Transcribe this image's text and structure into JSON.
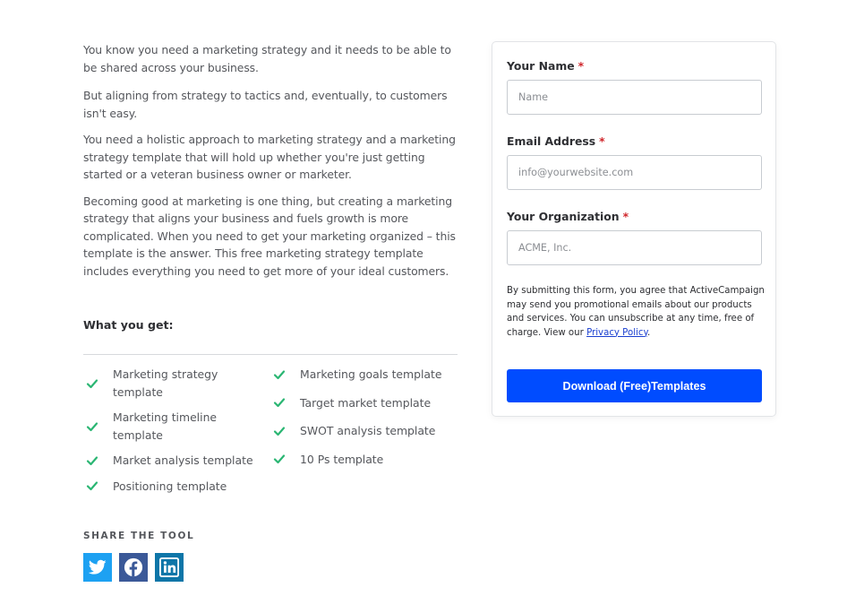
{
  "intro": {
    "paragraphs": [
      "You know you need a marketing strategy and it needs to be able to be shared across your business.",
      "But aligning from strategy to tactics and, eventually, to customers isn't easy.",
      "You need a holistic approach to marketing strategy and a marketing strategy template that will hold up whether you're just getting started or a veteran business owner or marketer.",
      "Becoming good at marketing is one thing, but creating a marketing strategy that aligns your business and fuels growth is more complicated. When you need to get your marketing organized – this template is the answer. This free marketing strategy template includes everything you need to get more of your ideal customers."
    ]
  },
  "what_you_get": {
    "title": "What you get:",
    "column1": [
      "Marketing strategy template",
      "Marketing timeline template",
      "Market analysis template",
      "Positioning template"
    ],
    "column2": [
      "Marketing goals template",
      "Target market template",
      "SWOT analysis template",
      "10 Ps template"
    ],
    "check_icon": "checkmark-icon",
    "check_color": "#2bb673"
  },
  "share": {
    "title": "SHARE THE TOOL",
    "networks": [
      {
        "name": "Twitter",
        "icon": "twitter-icon",
        "color": "#1da1f2"
      },
      {
        "name": "Facebook",
        "icon": "facebook-icon",
        "color": "#3b5998"
      },
      {
        "name": "LinkedIn",
        "icon": "linkedin-icon",
        "color": "#0e76a8"
      }
    ]
  },
  "form": {
    "name_label": "Your Name",
    "name_placeholder": "Name",
    "email_label": "Email Address",
    "email_placeholder": "info@yourwebsite.com",
    "org_label": "Your Organization",
    "org_placeholder": "ACME, Inc.",
    "required_mark": "*",
    "consent_text": "By submitting this form, you agree that ActiveCampaign may send you promotional emails about our products and services. You can unsubscribe at any time, free of charge. View our ",
    "privacy_link": "Privacy Policy",
    "consent_end": ".",
    "submit_label": "Download (Free)Templates",
    "accent_color": "#004cff",
    "required_color": "#d0262b"
  }
}
